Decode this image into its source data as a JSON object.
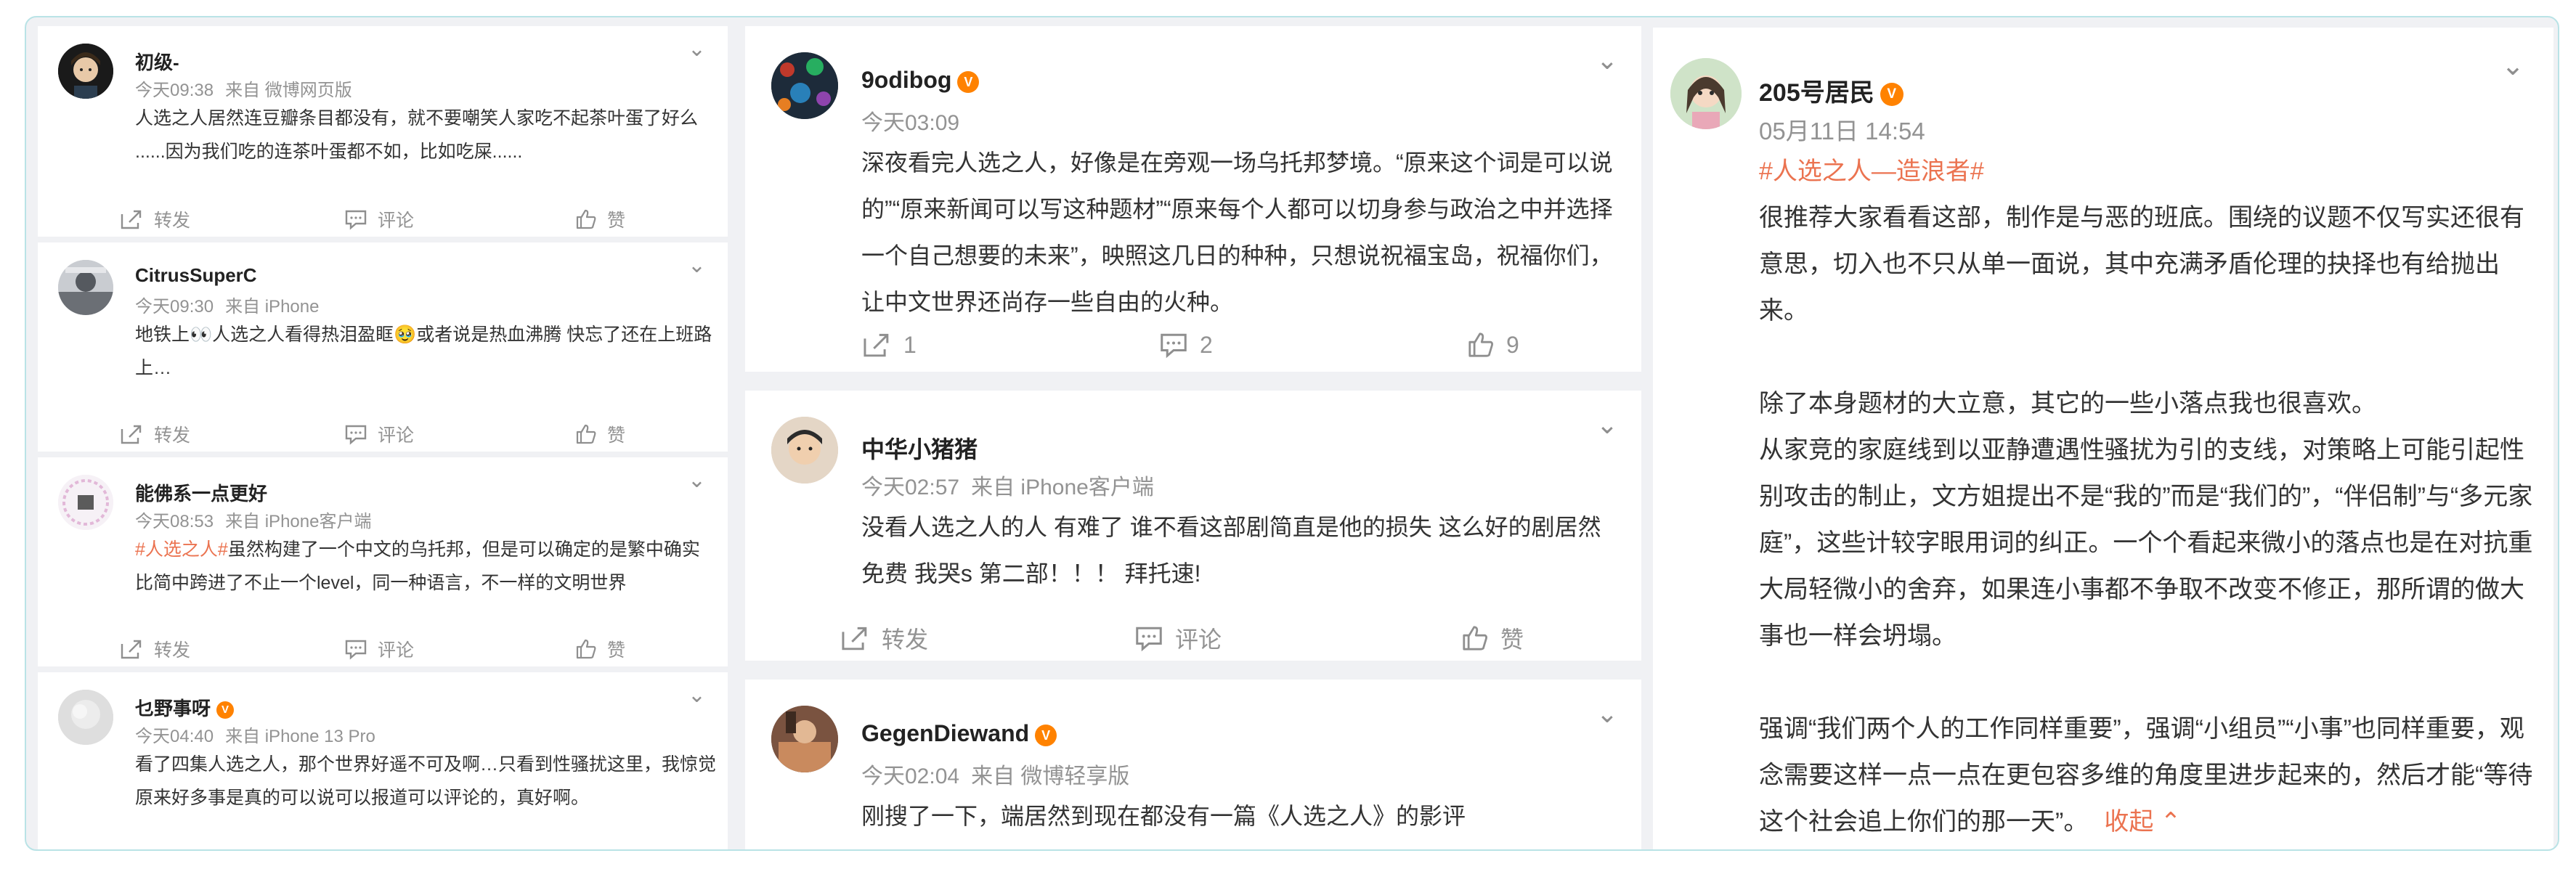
{
  "accent": "#eb7350",
  "verified_badge": "V",
  "col1": [
    {
      "name": "初级-",
      "time": "今天09:38",
      "source": "来自 微博网页版",
      "text": "人选之人居然连豆瓣条目都没有，就不要嘲笑人家吃不起茶叶蛋了好么 ......因为我们吃的连茶叶蛋都不如，比如吃屎......",
      "repost": "转发",
      "comment": "评论",
      "like": "赞"
    },
    {
      "name": "CitrusSuperC",
      "time": "今天09:30",
      "source": "来自 iPhone",
      "text": "地铁上👀人选之人看得热泪盈眶🥹或者说是热血沸腾 快忘了还在上班路上…",
      "repost": "转发",
      "comment": "评论",
      "like": "赞"
    },
    {
      "name": "能佛系一点更好",
      "time": "今天08:53",
      "source": "来自 iPhone客户端",
      "tag": "#人选之人#",
      "text": "虽然构建了一个中文的乌托邦，但是可以确定的是繁中确实比简中跨进了不止一个level，同一种语言，不一样的文明世界",
      "repost": "转发",
      "comment": "评论",
      "like": "赞"
    },
    {
      "name": "乜野事呀",
      "time": "今天04:40",
      "source": "来自 iPhone 13 Pro",
      "text": "看了四集人选之人，那个世界好遥不可及啊…只看到性骚扰这里，我惊觉原来好多事是真的可以说可以报道可以评论的，真好啊。"
    }
  ],
  "col2": [
    {
      "name": "9odibog",
      "time": "今天03:09",
      "text": "深夜看完人选之人，好像是在旁观一场乌托邦梦境。“原来这个词是可以说的”“原来新闻可以写这种题材”“原来每个人都可以切身参与政治之中并选择一个自己想要的未来”，映照这几日的种种，只想说祝福宝岛，祝福你们，让中文世界还尚存一些自由的火种。",
      "repost": "1",
      "comment": "2",
      "like": "9"
    },
    {
      "name": "中华小猪猪",
      "time": "今天02:57",
      "source": "来自 iPhone客户端",
      "text": "没看人选之人的人 有难了 谁不看这部剧简直是他的损失 这么好的剧居然免费 我哭s 第二部！！！ 拜托速!",
      "repost": "转发",
      "comment": "评论",
      "like": "赞"
    },
    {
      "name": "GegenDiewand",
      "time": "今天02:04",
      "source": "来自 微博轻享版",
      "text": "刚搜了一下，端居然到现在都没有一篇《人选之人》的影评"
    }
  ],
  "col3": {
    "name": "205号居民",
    "time": "05月11日 14:54",
    "tag": "#人选之人—造浪者#",
    "paragraphs": [
      "很推荐大家看看这部，制作是与恶的班底。围绕的议题不仅写实还很有意思，切入也不只从单一面说，其中充满矛盾伦理的抉择也有给抛出来。",
      "",
      "除了本身题材的大立意，其它的一些小落点我也很喜欢。",
      "从家竞的家庭线到以亚静遭遇性骚扰为引的支线，对策略上可能引起性别攻击的制止，文方姐提出不是“我的”而是“我们的”，“伴侣制”与“多元家庭”，这些计较字眼用词的纠正。一个个看起来微小的落点也是在对抗重大局轻微小的舍弃，如果连小事都不争取不改变不修正，那所谓的做大事也一样会坍塌。",
      "",
      "强调“我们两个人的工作同样重要”，强调“小组员”“小事”也同样重要，观念需要这样一点一点在更包容多维的角度里进步起来的，然后才能“等待这个社会追上你们的那一天”。"
    ],
    "collapse": "收起"
  }
}
